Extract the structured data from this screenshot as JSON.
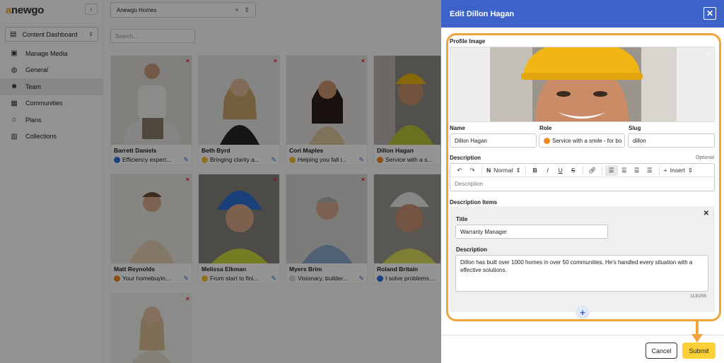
{
  "app": {
    "logo_prefix": "a",
    "logo_text": "newgo",
    "collapse_icon": "chevron-left-icon",
    "dashboard_select": "Content Dashboard",
    "builder_select": "Anewgo Homes",
    "search_placeholder": "Search..."
  },
  "nav": [
    {
      "label": "Manage Media",
      "icon": "media-icon"
    },
    {
      "label": "General",
      "icon": "globe-icon"
    },
    {
      "label": "Team",
      "icon": "team-icon",
      "active": true
    },
    {
      "label": "Communities",
      "icon": "communities-icon"
    },
    {
      "label": "Plans",
      "icon": "home-icon"
    },
    {
      "label": "Collections",
      "icon": "collections-icon"
    }
  ],
  "team": [
    {
      "name": "Barrett Daniels",
      "role": "Efficiency expert...",
      "emoji_color": "#2f6fd8"
    },
    {
      "name": "Beth Byrd",
      "role": "Bringing clarity a...",
      "emoji_color": "#f2c230"
    },
    {
      "name": "Cori Maples",
      "role": "Helping you fall i...",
      "emoji_color": "#f2c230"
    },
    {
      "name": "Dillon Hagan",
      "role": "Service with a s...",
      "emoji_color": "#f08a24"
    },
    {
      "name": "Matt Reynolds",
      "role": "Your homebuyin...",
      "emoji_color": "#f08a24"
    },
    {
      "name": "Melissa Elkman",
      "role": "From start to fini...",
      "emoji_color": "#f2c230"
    },
    {
      "name": "Myers Brim",
      "role": "Visionary, builder...",
      "emoji_color": "#d9d9d9"
    },
    {
      "name": "Roland Britain",
      "role": "I solve problems....",
      "emoji_color": "#2f6fd8"
    },
    {
      "name": "",
      "role": "",
      "emoji_color": "#ffffff"
    }
  ],
  "modal": {
    "title": "Edit Dillon Hagan",
    "profile_image_label": "Profile Image",
    "name_label": "Name",
    "name_value": "Dillon Hagan",
    "role_label": "Role",
    "role_value": "Service with a smile - for bo",
    "slug_label": "Slug",
    "slug_value": "dillon",
    "description_label": "Description",
    "optional_label": "Optional",
    "toolbar": {
      "block_prefix": "N",
      "block_style": "Normal",
      "bold": "B",
      "italic": "I",
      "underline": "U",
      "strike": "S",
      "insert": "Insert"
    },
    "description_placeholder": "Description",
    "description_items_label": "Description Items",
    "item": {
      "title_label": "Title",
      "title_value": "Warranty Manager",
      "description_label": "Description",
      "description_value": "Dillon has built over 1000 homes in over 50 communities. He's handled every situation with a effective solutions.",
      "counter": "113/255"
    },
    "cancel_label": "Cancel",
    "submit_label": "Submit",
    "accent_color": "#3d63c9",
    "highlight_color": "#f2a33a",
    "submit_color": "#fbd036"
  }
}
